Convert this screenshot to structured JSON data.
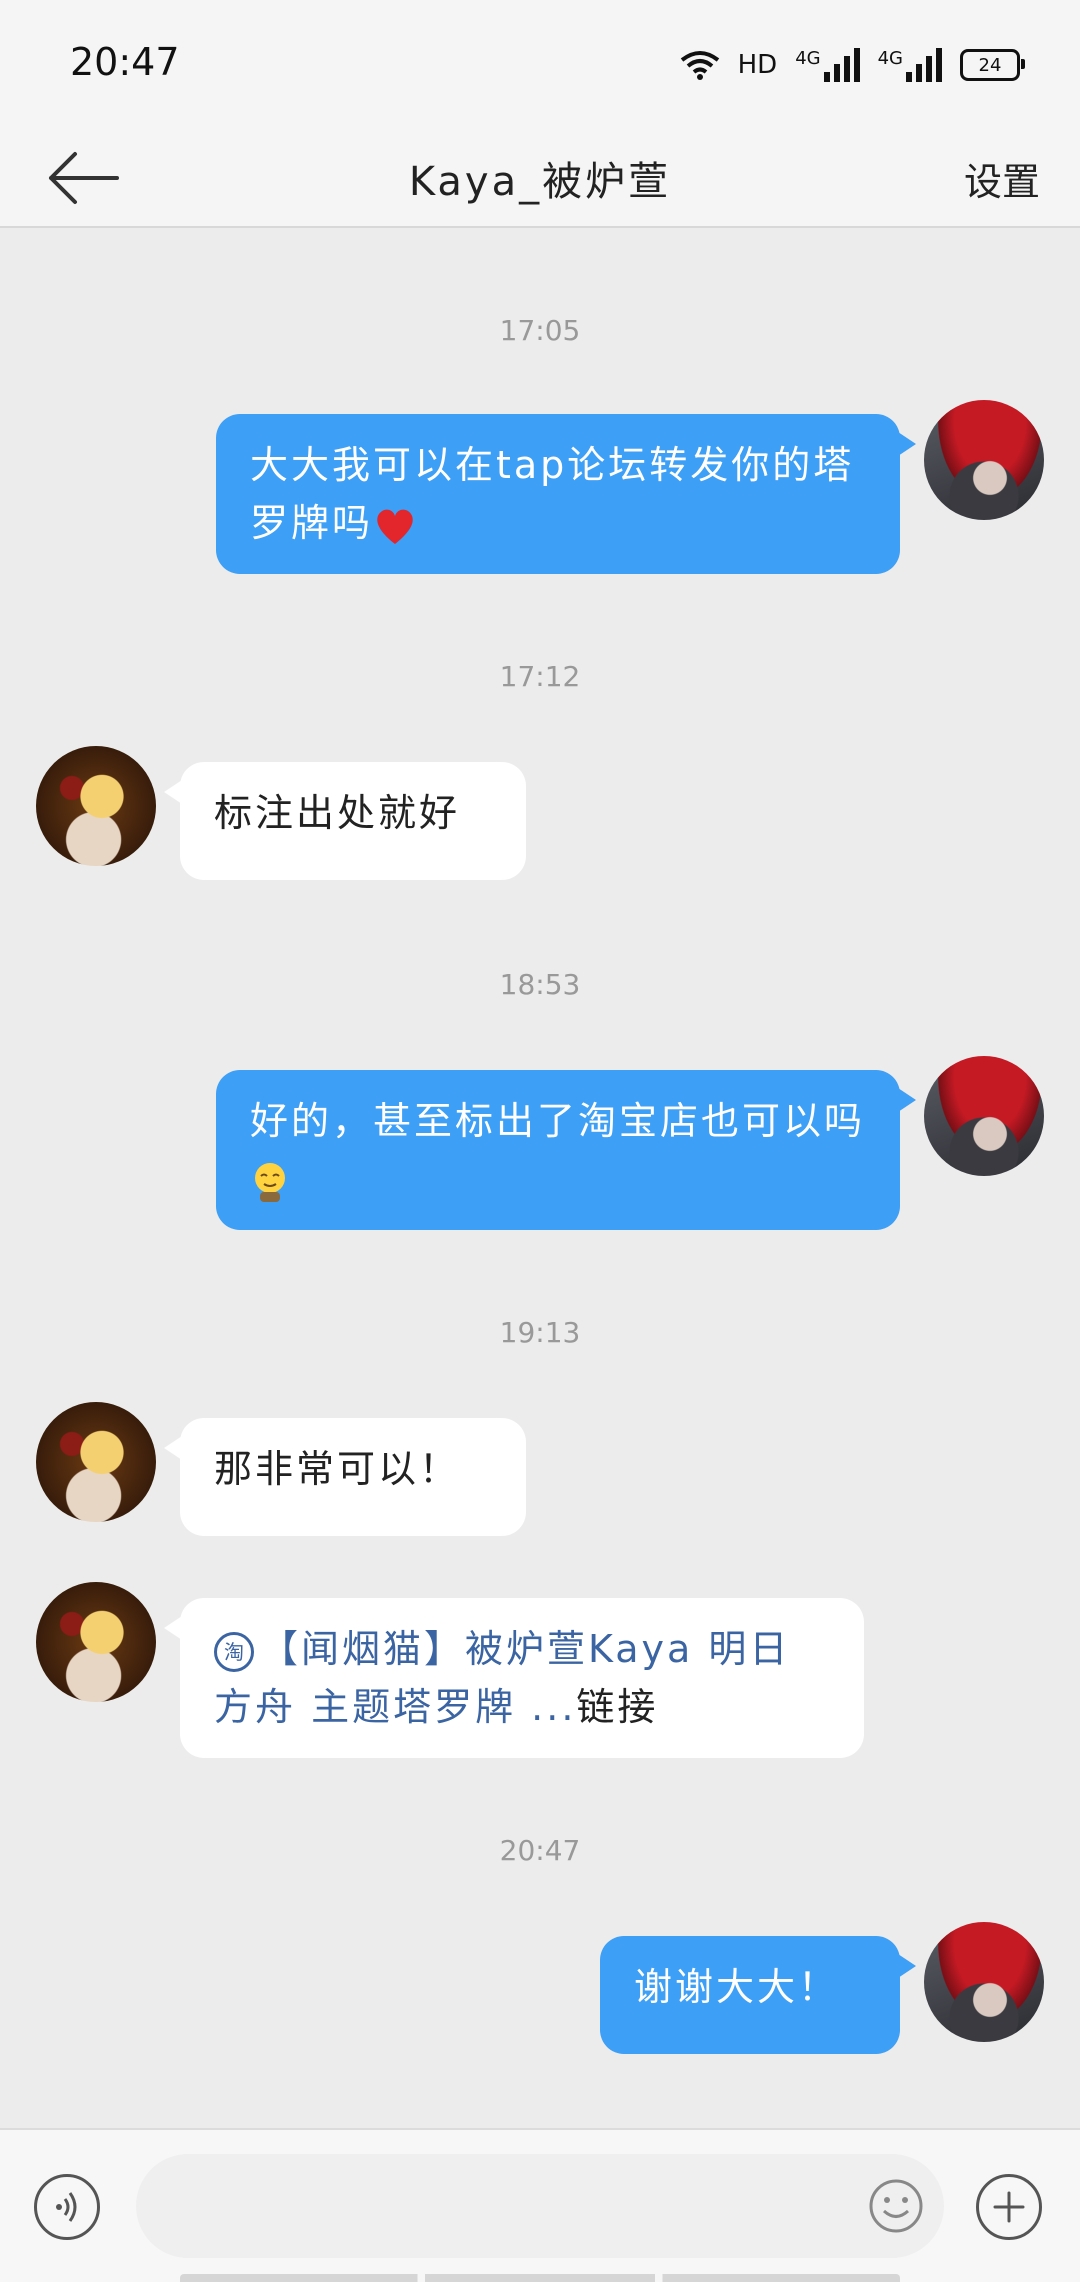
{
  "status_bar": {
    "time": "20:47",
    "network_label": "HD",
    "signal1_label": "4G",
    "signal2_label": "4G",
    "battery": "24"
  },
  "header": {
    "title": "Kaya_被炉萱",
    "settings_label": "设置"
  },
  "messages": [
    {
      "timestamp": "17:05",
      "side": "out",
      "text": "大大我可以在tap论坛转发你的塔罗牌吗",
      "emoji": "heart"
    },
    {
      "timestamp": "17:12",
      "side": "in",
      "text": "标注出处就好"
    },
    {
      "timestamp": "18:53",
      "side": "out",
      "text": "好的，甚至标出了淘宝店也可以吗",
      "emoji": "hug-face"
    },
    {
      "timestamp": "19:13",
      "side": "in",
      "text": "那非常可以！"
    },
    {
      "side": "in",
      "type": "link",
      "badge": "淘",
      "link_text": "【闻烟猫】被炉萱Kaya 明日方舟 主题塔罗牌 ...",
      "link_tail": "链接"
    },
    {
      "timestamp": "20:47",
      "side": "out",
      "text": "谢谢大大！"
    }
  ],
  "input": {
    "placeholder": ""
  },
  "colors": {
    "outgoing_bubble": "#3d9ff5",
    "incoming_bubble": "#ffffff",
    "link_text": "#3b64a3",
    "background": "#ececec"
  }
}
